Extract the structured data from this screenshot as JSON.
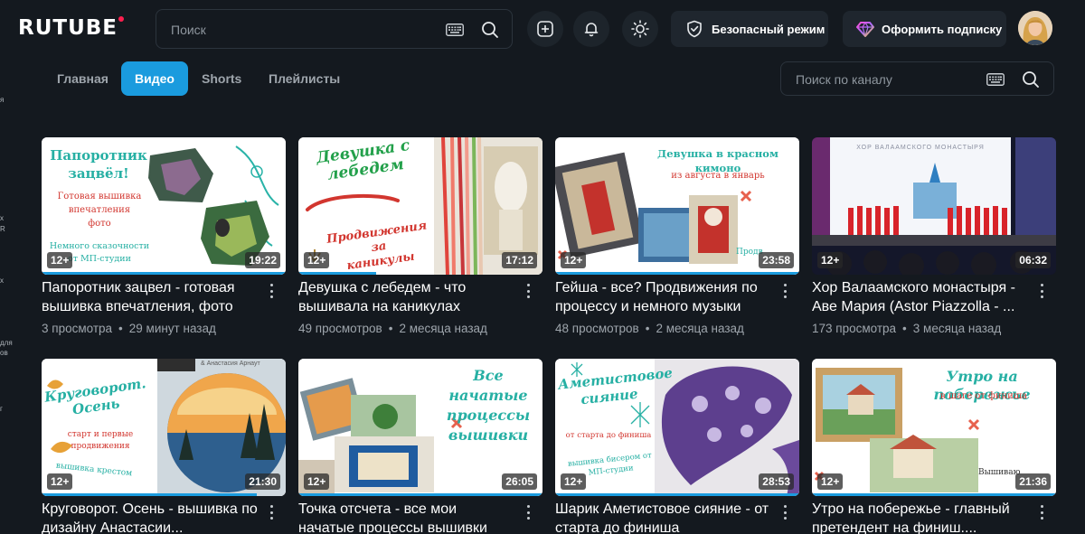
{
  "header": {
    "logo": "RUTUBE",
    "search_placeholder": "Поиск",
    "safe_mode_label": "Безопасный режим",
    "subscribe_label": "Оформить подписку",
    "colors": {
      "accent": "#1a9bde",
      "logo_dot": "#ff1f4f",
      "background": "#14191f"
    }
  },
  "left_rail": {
    "fragments": [
      "я",
      "x",
      "R",
      "x",
      "для",
      "ов",
      "г"
    ]
  },
  "tabs": [
    {
      "label": "Главная",
      "active": false
    },
    {
      "label": "Видео",
      "active": true
    },
    {
      "label": "Shorts",
      "active": false
    },
    {
      "label": "Плейлисты",
      "active": false
    }
  ],
  "channel_search_placeholder": "Поиск по каналу",
  "videos": [
    {
      "title": "Папоротник зацвел - готовая вышивка впечатления, фото",
      "views": "3 просмотра",
      "age": "29 минут назад",
      "duration": "19:22",
      "rating": "12+",
      "progress": 1.0,
      "thumb_text": [
        "Папоротник зацвёл!",
        "Готовая вышивка",
        "впечатления",
        "фото",
        "Немного сказочности",
        "от МП-студии"
      ]
    },
    {
      "title": "Девушка с лебедем - что вышивала на каникулах",
      "views": "49 просмотров",
      "age": "2 месяца назад",
      "duration": "17:12",
      "rating": "12+",
      "progress": 0.32,
      "thumb_text": [
        "Девушка с",
        "лебедем",
        "Продвижения за",
        "каникулы"
      ]
    },
    {
      "title": "Гейша - все? Продвижения по процессу и немного музыки",
      "views": "48 просмотров",
      "age": "2 месяца назад",
      "duration": "23:58",
      "rating": "12+",
      "progress": 1.0,
      "thumb_text": [
        "Девушка в красном кимоно",
        "из августа в январь",
        "Продв"
      ]
    },
    {
      "title": "Хор Валаамского монастыря - Аве Мария (Astor Piazzolla - ...",
      "views": "173 просмотра",
      "age": "3 месяца назад",
      "duration": "06:32",
      "rating": "12+",
      "progress": 0,
      "thumb_text": [
        "ХОР ВАЛААМСКОГО МОНАСТЫРЯ"
      ]
    },
    {
      "title": "Круговорот. Осень - вышивка по дизайну Анастасии...",
      "views": "",
      "age": "",
      "duration": "21:30",
      "rating": "12+",
      "progress": 0.88,
      "thumb_text": [
        "Круговорот.",
        "Осень",
        "старт и первые",
        "продвижения",
        "вышивка крестом",
        "& Анастасия Арнаут"
      ]
    },
    {
      "title": "Точка отсчета - все мои начатые процессы вышивки",
      "views": "",
      "age": "",
      "duration": "26:05",
      "rating": "12+",
      "progress": 1.0,
      "thumb_text": [
        "Все начатые",
        "процессы",
        "вышивки"
      ]
    },
    {
      "title": "Шарик Аметистовое сияние - от старта до финиша",
      "views": "",
      "age": "",
      "duration": "28:53",
      "rating": "12+",
      "progress": 1.0,
      "thumb_text": [
        "Аметистовое",
        "сияние",
        "от старта до финиша",
        "вышивка бисером от",
        "МП-студии"
      ]
    },
    {
      "title": "Утро на побережье - главный претендент на финиш....",
      "views": "",
      "age": "",
      "duration": "21:36",
      "rating": "12+",
      "progress": 1.0,
      "thumb_text": [
        "Утро на побережье",
        "в шаге от финиша",
        "Вышиваю"
      ]
    }
  ]
}
